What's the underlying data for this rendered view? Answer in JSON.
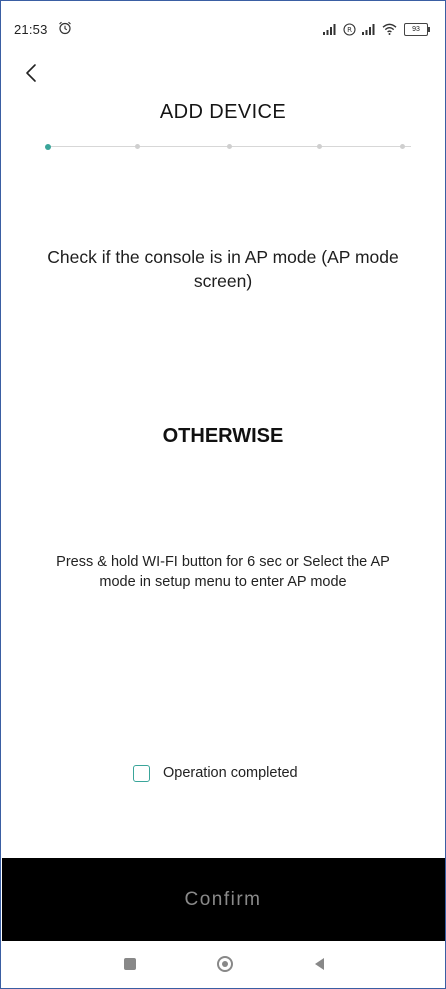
{
  "status_bar": {
    "time": "21:53",
    "battery": "93"
  },
  "header": {
    "title": "ADD DEVICE"
  },
  "stepper": {
    "total_steps": 5,
    "current_step": 1
  },
  "content": {
    "instruction": "Check if the console is in AP mode (AP mode screen)",
    "otherwise": "OTHERWISE",
    "secondary_instruction": "Press & hold WI-FI button for 6 sec or Select the AP mode in setup menu to enter AP mode"
  },
  "operation_check": {
    "label": "Operation completed",
    "checked": false
  },
  "confirm": {
    "label": "Confirm"
  },
  "colors": {
    "accent": "#3aa59a",
    "confirm_bg": "#000000",
    "confirm_text": "#8a8a8a"
  },
  "icons": {
    "alarm": "alarm-clock-icon",
    "back": "chevron-left-icon",
    "nav_recents": "square-icon",
    "nav_home": "circle-icon",
    "nav_back": "triangle-back-icon"
  }
}
